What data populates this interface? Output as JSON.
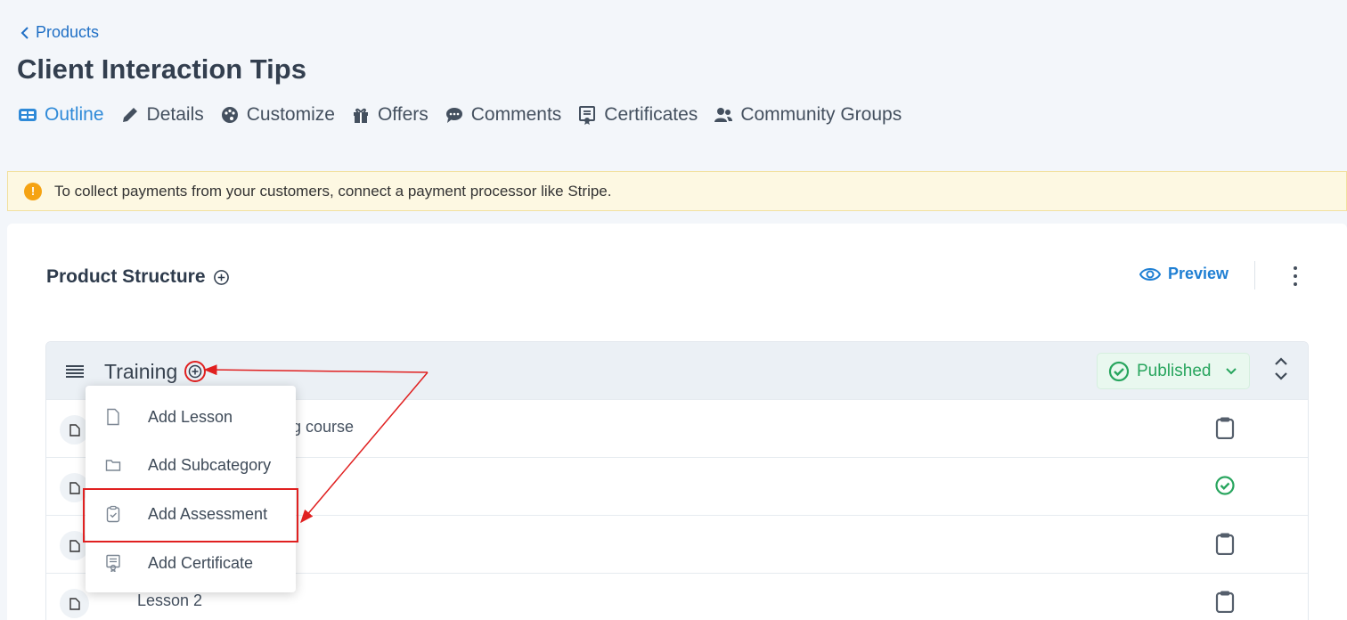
{
  "breadcrumb": {
    "back_label": "Products"
  },
  "page_title": "Client Interaction Tips",
  "tabs": [
    {
      "label": "Outline",
      "icon": "outline-icon",
      "active": true
    },
    {
      "label": "Details",
      "icon": "pencil-icon"
    },
    {
      "label": "Customize",
      "icon": "palette-icon"
    },
    {
      "label": "Offers",
      "icon": "gift-icon"
    },
    {
      "label": "Comments",
      "icon": "comment-icon"
    },
    {
      "label": "Certificates",
      "icon": "certificate-icon"
    },
    {
      "label": "Community Groups",
      "icon": "users-icon"
    }
  ],
  "banner": {
    "icon": "warning-icon",
    "text": "To collect payments from your customers, connect a payment processor like Stripe."
  },
  "structure": {
    "title": "Product Structure",
    "preview_label": "Preview",
    "section": {
      "title": "Training",
      "status": "Published",
      "rows": [
        {
          "title": "ing course",
          "status_icon": "clipboard-icon"
        },
        {
          "title": "",
          "status_icon": "check-circle-icon"
        },
        {
          "title": "",
          "status_icon": "clipboard-icon"
        },
        {
          "title": "Lesson 2",
          "status_icon": "clipboard-icon"
        }
      ]
    }
  },
  "add_menu": {
    "items": [
      {
        "label": "Add Lesson",
        "icon": "file-icon"
      },
      {
        "label": "Add Subcategory",
        "icon": "folder-icon"
      },
      {
        "label": "Add Assessment",
        "icon": "clipboard-check-icon",
        "highlighted": true
      },
      {
        "label": "Add Certificate",
        "icon": "certificate-icon"
      }
    ]
  },
  "colors": {
    "accent": "#2f8ad8",
    "published": "#28a55e",
    "annotation": "#e02020",
    "banner_bg": "#fdf8e2"
  }
}
